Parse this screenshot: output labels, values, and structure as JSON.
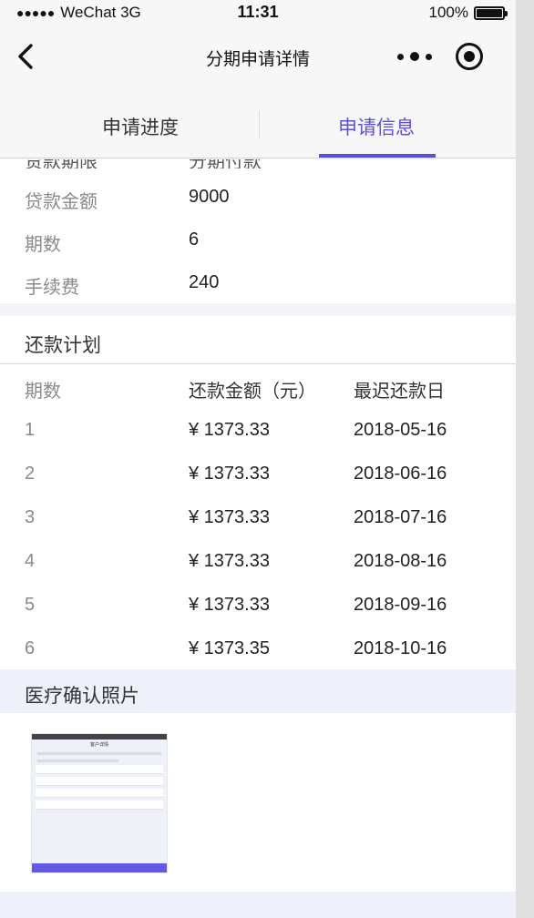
{
  "status_bar": {
    "signal": "●●●●●",
    "carrier": "WeChat 3G",
    "time": "11:31",
    "battery": "100%",
    "battery_level": 1.0
  },
  "nav": {
    "title": "分期申请详情",
    "icons": [
      "back-arrow-icon",
      "more-dots-icon",
      "target-circle-icon"
    ]
  },
  "tabs": {
    "items": [
      {
        "label": "申请进度",
        "active": false
      },
      {
        "label": "申请信息",
        "active": true
      }
    ],
    "active_color": "#5b4fe0"
  },
  "partial_row": {
    "label": "贷款期限",
    "value": "分期付款"
  },
  "loan_info": [
    {
      "label": "贷款金额",
      "value": "9000"
    },
    {
      "label": "期数",
      "value": "6"
    },
    {
      "label": "手续费",
      "value": "240"
    }
  ],
  "repayment_plan": {
    "title": "还款计划",
    "headers": [
      "期数",
      "还款金额（元）",
      "最迟还款日"
    ],
    "rows": [
      {
        "period": "1",
        "amount": "¥ 1373.33",
        "date": "2018-05-16"
      },
      {
        "period": "2",
        "amount": "¥ 1373.33",
        "date": "2018-06-16"
      },
      {
        "period": "3",
        "amount": "¥ 1373.33",
        "date": "2018-07-16"
      },
      {
        "period": "4",
        "amount": "¥ 1373.33",
        "date": "2018-08-16"
      },
      {
        "period": "5",
        "amount": "¥ 1373.33",
        "date": "2018-09-16"
      },
      {
        "period": "6",
        "amount": "¥ 1373.35",
        "date": "2018-10-16"
      }
    ]
  },
  "medical_photo": {
    "title": "医疗确认照片",
    "thumb_title": "客户详情"
  }
}
